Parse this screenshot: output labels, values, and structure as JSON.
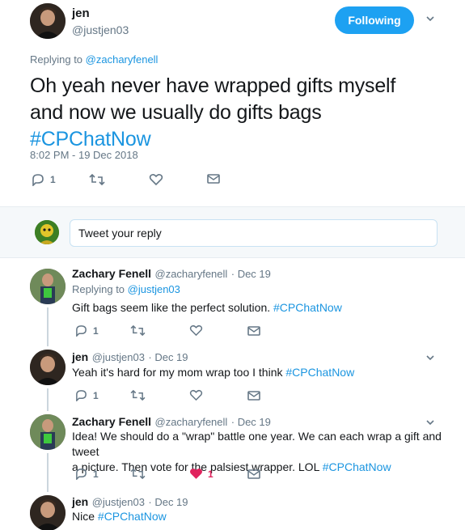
{
  "main_tweet": {
    "display_name": "jen",
    "handle": "@justjen03",
    "follow_label": "Following",
    "replying_prefix": "Replying to ",
    "replying_to": "@zacharyfenell",
    "text_line1": "Oh yeah never have wrapped gifts myself",
    "text_line2": "and now we usually do gifts bags",
    "hashtag": "#CPChatNow",
    "timestamp": "8:02 PM - 19 Dec 2018",
    "reply_count": "1"
  },
  "reply_box": {
    "placeholder": "Tweet your reply"
  },
  "replies": [
    {
      "display_name": "Zachary Fenell",
      "handle": "@zacharyfenell",
      "date": "· Dec 19",
      "replying_prefix": "Replying to ",
      "replying_to": "@justjen03",
      "text": "Gift bags seem like the perfect solution. ",
      "hashtag": "#CPChatNow",
      "reply_count": "1"
    },
    {
      "display_name": "jen",
      "handle": "@justjen03",
      "date": "· Dec 19",
      "text": "Yeah it's hard for my mom wrap too I think ",
      "hashtag": "#CPChatNow",
      "reply_count": "1"
    },
    {
      "display_name": "Zachary Fenell",
      "handle": "@zacharyfenell",
      "date": "· Dec 19",
      "text_line1": "Idea! We should do a \"wrap\" battle one year. We can each wrap a gift and tweet",
      "text_line2": "a picture. Then vote for the palsiest wrapper. LOL ",
      "hashtag": "#CPChatNow",
      "reply_count": "1",
      "like_count": "1",
      "like_color": "#e0245e"
    },
    {
      "display_name": "jen",
      "handle": "@justjen03",
      "date": "· Dec 19",
      "text": "Nice ",
      "hashtag": "#CPChatNow"
    }
  ],
  "colors": {
    "accent": "#1da1f2",
    "link": "#1b95e0",
    "muted": "#657786"
  }
}
